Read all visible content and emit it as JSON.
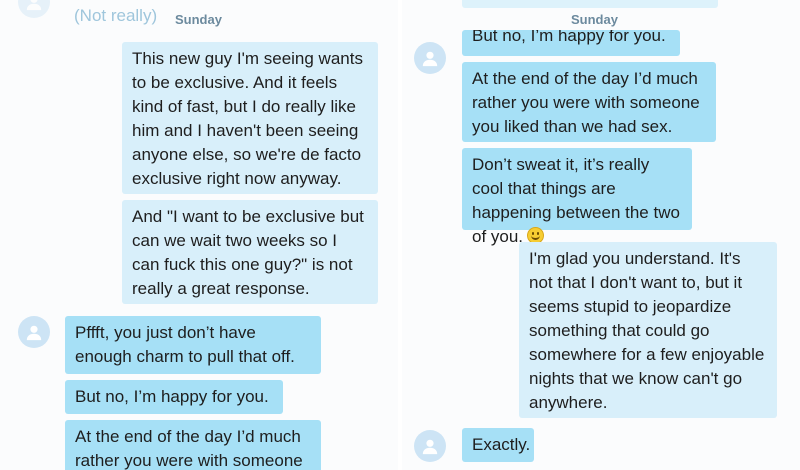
{
  "left": {
    "top_faded": "(Not really)",
    "day": "Sunday",
    "messages": [
      {
        "text": "This new guy I'm seeing wants to be exclusive. And it feels kind of fast, but I do really like him and I haven't been seeing anyone else, so we're de facto exclusive right now anyway."
      },
      {
        "text": "And \"I want to be exclusive but can we wait two weeks so I can fuck this one guy?\" is not really a great response."
      },
      {
        "text": "Pffft, you just don’t have enough charm to pull that off."
      },
      {
        "text": "But no, I’m happy for you."
      },
      {
        "text": "At the end of the day I’d much rather you were with someone"
      }
    ]
  },
  "right": {
    "top_faded": "",
    "day": "Sunday",
    "messages": [
      {
        "text": "But no, I’m happy for you."
      },
      {
        "text": "At the end of the day I’d much rather you were with someone you liked than we had sex."
      },
      {
        "text": "Don’t sweat it, it’s really cool that things are happening between the two of you."
      },
      {
        "text": "I'm glad you understand. It's not that I don't want to, but it seems stupid to jeopardize something that could go somewhere for a few enjoyable nights that we know can't go anywhere."
      },
      {
        "text": "Exactly."
      }
    ],
    "emoji": "smiley-emoji"
  },
  "colors": {
    "incoming_bubble": "#a6e0f6",
    "outgoing_bubble": "#d8effa",
    "avatar": "#cde4f5",
    "day_label": "#6c8a9e"
  }
}
